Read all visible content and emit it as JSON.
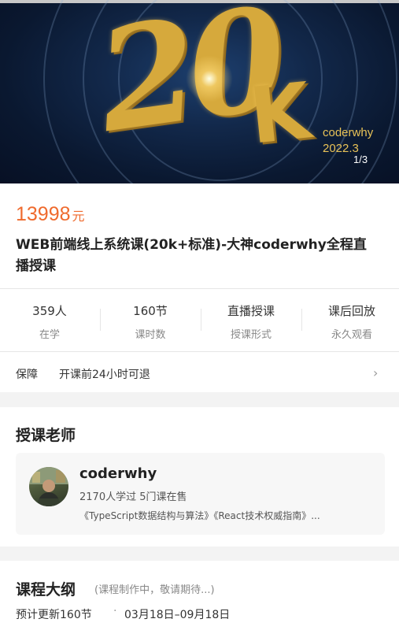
{
  "banner": {
    "big_text": "20",
    "big_k": "K",
    "brand": "coderwhy",
    "year": "2022.3",
    "counter": "1/3"
  },
  "course": {
    "price": "13998",
    "currency": "元",
    "title": "WEB前端线上系统课(20k+标准)-大神coderwhy全程直播授课"
  },
  "stats": [
    {
      "value": "359人",
      "label": "在学"
    },
    {
      "value": "160节",
      "label": "课时数"
    },
    {
      "value": "直播授课",
      "label": "授课形式"
    },
    {
      "value": "课后回放",
      "label": "永久观看"
    }
  ],
  "guarantee": {
    "label": "保障",
    "text": "开课前24小时可退"
  },
  "teacher": {
    "section_title": "授课老师",
    "name": "coderwhy",
    "meta": "2170人学过  5门课在售",
    "courses": "《TypeScript数据结构与算法》《React技术权威指南》..."
  },
  "outline": {
    "title": "课程大纲",
    "subtitle": "(课程制作中，敬请期待...)",
    "count": "预计更新160节",
    "dates": "03月18日–09月18日"
  },
  "colors": {
    "price": "#ef6a2d",
    "gold": "#d6a93c"
  }
}
